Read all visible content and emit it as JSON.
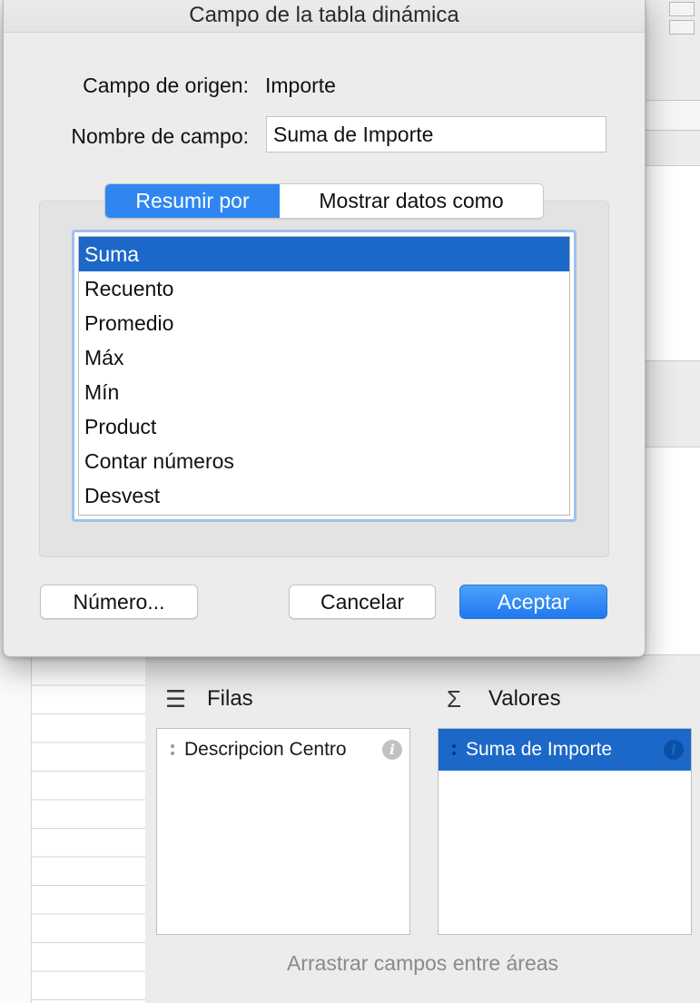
{
  "dialog": {
    "title": "Campo de la tabla dinámica",
    "source_label": "Campo de origen:",
    "source_value": "Importe",
    "name_label": "Nombre de campo:",
    "name_value": "Suma de Importe",
    "tabs": [
      {
        "label": "Resumir por",
        "active": true
      },
      {
        "label": "Mostrar datos como",
        "active": false
      }
    ],
    "functions": [
      {
        "label": "Suma",
        "selected": true
      },
      {
        "label": "Recuento",
        "selected": false
      },
      {
        "label": "Promedio",
        "selected": false
      },
      {
        "label": "Máx",
        "selected": false
      },
      {
        "label": "Mín",
        "selected": false
      },
      {
        "label": "Product",
        "selected": false
      },
      {
        "label": "Contar números",
        "selected": false
      },
      {
        "label": "Desvest",
        "selected": false
      }
    ],
    "number_button": "Número...",
    "cancel_button": "Cancelar",
    "ok_button": "Aceptar"
  },
  "pane": {
    "rows_area": {
      "title": "Filas",
      "icon": "rows-icon",
      "fields": [
        "Descripcion Centro"
      ]
    },
    "values_area": {
      "title": "Valores",
      "icon": "sigma-icon",
      "fields": [
        "Suma de Importe"
      ]
    },
    "hint": "Arrastrar campos entre áreas"
  },
  "colors": {
    "accent": "#2f86f0",
    "selection": "#1c68c9",
    "dialog_bg": "#ececec"
  }
}
